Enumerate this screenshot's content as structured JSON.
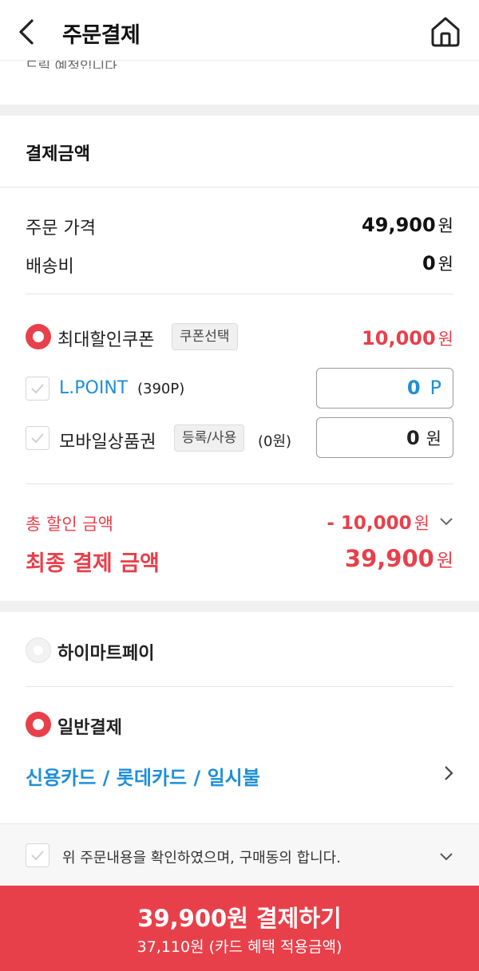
{
  "header": {
    "title": "주문결제"
  },
  "cut_text": "드릴 예정입니다.",
  "payment_amount": {
    "title": "결제금액",
    "order_price_label": "주문 가격",
    "order_price_value": "49,900",
    "shipping_label": "배송비",
    "shipping_value": "0",
    "unit_won": "원",
    "coupon_label": "최대할인쿠폰",
    "coupon_select_label": "쿠폰선택",
    "coupon_value": "10,000",
    "lpoint_label": "L.POINT",
    "lpoint_balance": "(390P)",
    "lpoint_input_value": "0",
    "lpoint_unit": "P",
    "gift_label": "모바일상품권",
    "gift_register_label": "등록/사용",
    "gift_balance": "(0원)",
    "gift_input_value": "0",
    "total_discount_label": "총 할인 금액",
    "total_discount_value": "- 10,000",
    "final_label": "최종 결제 금액",
    "final_value": "39,900"
  },
  "payment_method": {
    "himart_pay_label": "하이마트페이",
    "general_label": "일반결제",
    "card_selection": "신용카드 / 롯데카드 / 일시불"
  },
  "agreement": {
    "text": "위 주문내용을 확인하였으며, 구매동의 합니다."
  },
  "pay_button": {
    "main": "39,900원 결제하기",
    "sub": "37,110원 (카드 혜택 적용금액)"
  },
  "colors": {
    "accent": "#e8404a",
    "link": "#1f8fd6"
  }
}
